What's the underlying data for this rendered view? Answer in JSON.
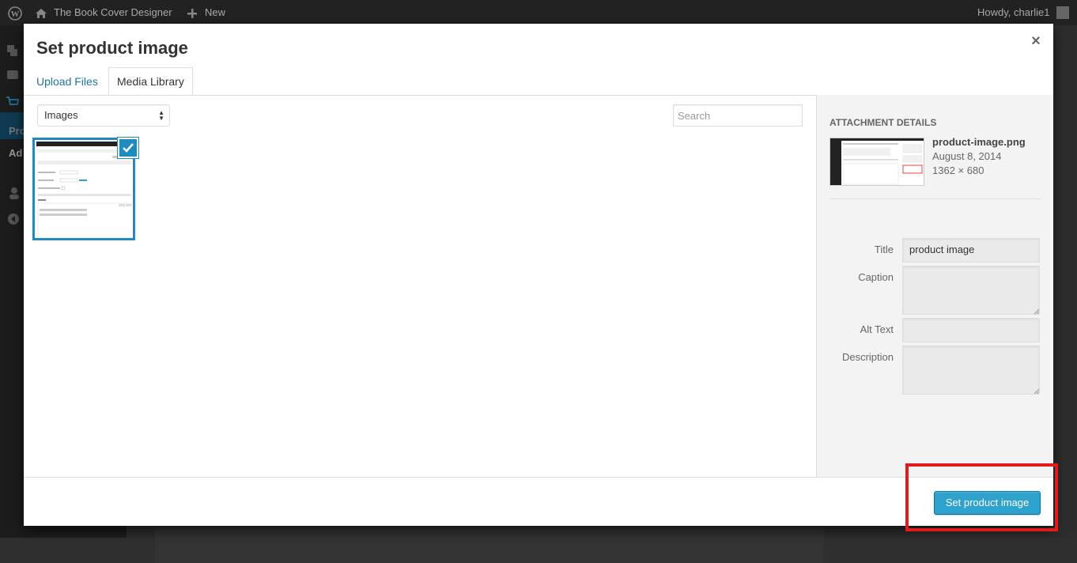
{
  "admin_bar": {
    "site_name": "The Book Cover Designer",
    "new_label": "New",
    "greeting": "Howdy, charlie1"
  },
  "admin_menu": {
    "partial_label_1": "Pro",
    "partial_label_2": "Ad"
  },
  "modal": {
    "title": "Set product image",
    "close_symbol": "×",
    "tabs": [
      {
        "label": "Upload Files",
        "active": false
      },
      {
        "label": "Media Library",
        "active": true
      }
    ],
    "filter": {
      "selected": "Images"
    },
    "search": {
      "placeholder": "Search",
      "value": ""
    },
    "attachment": {
      "selected": true
    }
  },
  "details": {
    "heading": "Attachment Details",
    "filename": "product-image.png",
    "date": "August 8, 2014",
    "dimensions": "1362 × 680",
    "fields": {
      "title": {
        "label": "Title",
        "value": "product image"
      },
      "caption": {
        "label": "Caption",
        "value": ""
      },
      "alt": {
        "label": "Alt Text",
        "value": ""
      },
      "description": {
        "label": "Description",
        "value": ""
      }
    }
  },
  "footer": {
    "primary_button": "Set product image"
  },
  "colors": {
    "accent": "#2ea2cc",
    "link": "#21759b",
    "selection": "#1e8cbe",
    "highlight": "#e21a1a"
  }
}
